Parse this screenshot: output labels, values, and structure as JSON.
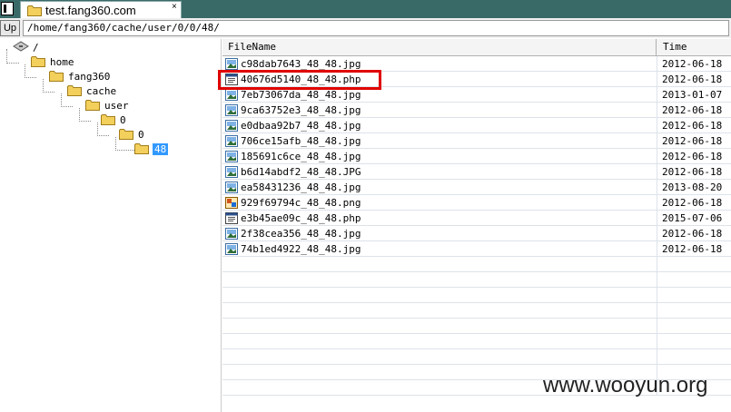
{
  "tab": {
    "title": "test.fang360.com",
    "close": "×"
  },
  "toolbar": {
    "up_label": "Up",
    "path": "/home/fang360/cache/user/0/0/48/"
  },
  "tree": {
    "root": "/",
    "nodes": [
      "home",
      "fang360",
      "cache",
      "user",
      "0",
      "0",
      "48"
    ]
  },
  "list": {
    "columns": {
      "name": "FileName",
      "time": "Time"
    },
    "files": [
      {
        "name": "c98dab7643_48_48.jpg",
        "time": "2012-06-18",
        "type": "image"
      },
      {
        "name": "40676d5140_48_48.php",
        "time": "2012-06-18",
        "type": "script"
      },
      {
        "name": "7eb73067da_48_48.jpg",
        "time": "2013-01-07",
        "type": "image"
      },
      {
        "name": "9ca63752e3_48_48.jpg",
        "time": "2012-06-18",
        "type": "image"
      },
      {
        "name": "e0dbaa92b7_48_48.jpg",
        "time": "2012-06-18",
        "type": "image"
      },
      {
        "name": "706ce15afb_48_48.jpg",
        "time": "2012-06-18",
        "type": "image"
      },
      {
        "name": "185691c6ce_48_48.jpg",
        "time": "2012-06-18",
        "type": "image"
      },
      {
        "name": "b6d14abdf2_48_48.JPG",
        "time": "2012-06-18",
        "type": "image"
      },
      {
        "name": "ea58431236_48_48.jpg",
        "time": "2013-08-20",
        "type": "image"
      },
      {
        "name": "929f69794c_48_48.png",
        "time": "2012-06-18",
        "type": "png"
      },
      {
        "name": "e3b45ae09c_48_48.php",
        "time": "2015-07-06",
        "type": "script"
      },
      {
        "name": "2f38cea356_48_48.jpg",
        "time": "2012-06-18",
        "type": "image"
      },
      {
        "name": "74b1ed4922_48_48.jpg",
        "time": "2012-06-18",
        "type": "image"
      }
    ],
    "empty_rows": 9
  },
  "watermark": "www.wooyun.org",
  "colors": {
    "tabbar": "#3a6a68",
    "selection": "#3399ff",
    "highlight": "#e00000",
    "folder": "#f3cf5c"
  }
}
